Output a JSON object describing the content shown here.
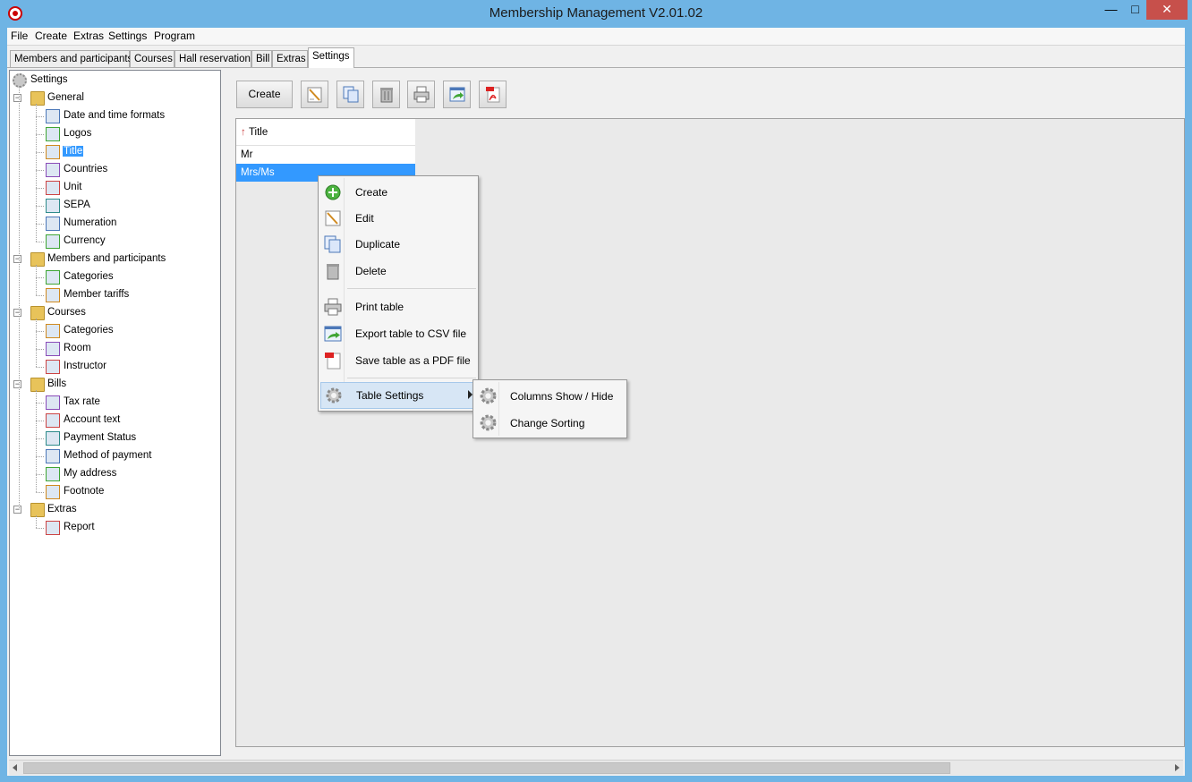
{
  "window": {
    "title": "Membership Management V2.01.02"
  },
  "menubar": [
    "File",
    "Create",
    "Extras",
    "Settings",
    "Program"
  ],
  "tabs": [
    "Members and participants",
    "Courses",
    "Hall reservation",
    "Bill",
    "Extras",
    "Settings"
  ],
  "active_tab": "Settings",
  "tree": {
    "root": "Settings",
    "groups": [
      {
        "label": "General",
        "items": [
          "Date and time formats",
          "Logos",
          "Title",
          "Countries",
          "Unit",
          "SEPA",
          "Numeration",
          "Currency"
        ]
      },
      {
        "label": "Members and participants",
        "items": [
          "Categories",
          "Member tariffs"
        ]
      },
      {
        "label": "Courses",
        "items": [
          "Categories",
          "Room",
          "Instructor"
        ]
      },
      {
        "label": "Bills",
        "items": [
          "Tax rate",
          "Account text",
          "Payment Status",
          "Method of payment",
          "My address",
          "Footnote"
        ]
      },
      {
        "label": "Extras",
        "items": [
          "Report"
        ]
      }
    ],
    "selected": "Title"
  },
  "toolbar": {
    "create_label": "Create"
  },
  "table": {
    "header": "Title",
    "sort_indicator": "↑",
    "rows": [
      "Mr",
      "Mrs/Ms"
    ],
    "selected_row": "Mrs/Ms"
  },
  "context_menu": {
    "items": [
      "Create",
      "Edit",
      "Duplicate",
      "Delete",
      "Print table",
      "Export table to CSV file",
      "Save table as a PDF file",
      "Table Settings"
    ],
    "highlighted": "Table Settings"
  },
  "submenu": {
    "items": [
      "Columns Show / Hide",
      "Change Sorting"
    ]
  },
  "colors": {
    "selection": "#3399ff",
    "titlebar": "#6fb4e4",
    "close": "#c7504b"
  }
}
